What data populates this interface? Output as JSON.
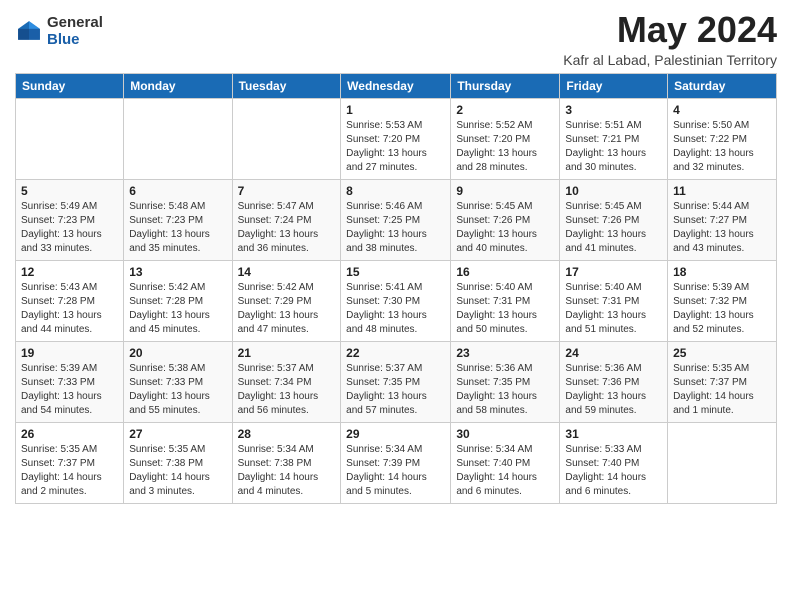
{
  "header": {
    "logo_general": "General",
    "logo_blue": "Blue",
    "month_year": "May 2024",
    "location": "Kafr al Labad, Palestinian Territory"
  },
  "days_of_week": [
    "Sunday",
    "Monday",
    "Tuesday",
    "Wednesday",
    "Thursday",
    "Friday",
    "Saturday"
  ],
  "weeks": [
    [
      {
        "day": "",
        "info": ""
      },
      {
        "day": "",
        "info": ""
      },
      {
        "day": "",
        "info": ""
      },
      {
        "day": "1",
        "info": "Sunrise: 5:53 AM\nSunset: 7:20 PM\nDaylight: 13 hours\nand 27 minutes."
      },
      {
        "day": "2",
        "info": "Sunrise: 5:52 AM\nSunset: 7:20 PM\nDaylight: 13 hours\nand 28 minutes."
      },
      {
        "day": "3",
        "info": "Sunrise: 5:51 AM\nSunset: 7:21 PM\nDaylight: 13 hours\nand 30 minutes."
      },
      {
        "day": "4",
        "info": "Sunrise: 5:50 AM\nSunset: 7:22 PM\nDaylight: 13 hours\nand 32 minutes."
      }
    ],
    [
      {
        "day": "5",
        "info": "Sunrise: 5:49 AM\nSunset: 7:23 PM\nDaylight: 13 hours\nand 33 minutes."
      },
      {
        "day": "6",
        "info": "Sunrise: 5:48 AM\nSunset: 7:23 PM\nDaylight: 13 hours\nand 35 minutes."
      },
      {
        "day": "7",
        "info": "Sunrise: 5:47 AM\nSunset: 7:24 PM\nDaylight: 13 hours\nand 36 minutes."
      },
      {
        "day": "8",
        "info": "Sunrise: 5:46 AM\nSunset: 7:25 PM\nDaylight: 13 hours\nand 38 minutes."
      },
      {
        "day": "9",
        "info": "Sunrise: 5:45 AM\nSunset: 7:26 PM\nDaylight: 13 hours\nand 40 minutes."
      },
      {
        "day": "10",
        "info": "Sunrise: 5:45 AM\nSunset: 7:26 PM\nDaylight: 13 hours\nand 41 minutes."
      },
      {
        "day": "11",
        "info": "Sunrise: 5:44 AM\nSunset: 7:27 PM\nDaylight: 13 hours\nand 43 minutes."
      }
    ],
    [
      {
        "day": "12",
        "info": "Sunrise: 5:43 AM\nSunset: 7:28 PM\nDaylight: 13 hours\nand 44 minutes."
      },
      {
        "day": "13",
        "info": "Sunrise: 5:42 AM\nSunset: 7:28 PM\nDaylight: 13 hours\nand 45 minutes."
      },
      {
        "day": "14",
        "info": "Sunrise: 5:42 AM\nSunset: 7:29 PM\nDaylight: 13 hours\nand 47 minutes."
      },
      {
        "day": "15",
        "info": "Sunrise: 5:41 AM\nSunset: 7:30 PM\nDaylight: 13 hours\nand 48 minutes."
      },
      {
        "day": "16",
        "info": "Sunrise: 5:40 AM\nSunset: 7:31 PM\nDaylight: 13 hours\nand 50 minutes."
      },
      {
        "day": "17",
        "info": "Sunrise: 5:40 AM\nSunset: 7:31 PM\nDaylight: 13 hours\nand 51 minutes."
      },
      {
        "day": "18",
        "info": "Sunrise: 5:39 AM\nSunset: 7:32 PM\nDaylight: 13 hours\nand 52 minutes."
      }
    ],
    [
      {
        "day": "19",
        "info": "Sunrise: 5:39 AM\nSunset: 7:33 PM\nDaylight: 13 hours\nand 54 minutes."
      },
      {
        "day": "20",
        "info": "Sunrise: 5:38 AM\nSunset: 7:33 PM\nDaylight: 13 hours\nand 55 minutes."
      },
      {
        "day": "21",
        "info": "Sunrise: 5:37 AM\nSunset: 7:34 PM\nDaylight: 13 hours\nand 56 minutes."
      },
      {
        "day": "22",
        "info": "Sunrise: 5:37 AM\nSunset: 7:35 PM\nDaylight: 13 hours\nand 57 minutes."
      },
      {
        "day": "23",
        "info": "Sunrise: 5:36 AM\nSunset: 7:35 PM\nDaylight: 13 hours\nand 58 minutes."
      },
      {
        "day": "24",
        "info": "Sunrise: 5:36 AM\nSunset: 7:36 PM\nDaylight: 13 hours\nand 59 minutes."
      },
      {
        "day": "25",
        "info": "Sunrise: 5:35 AM\nSunset: 7:37 PM\nDaylight: 14 hours\nand 1 minute."
      }
    ],
    [
      {
        "day": "26",
        "info": "Sunrise: 5:35 AM\nSunset: 7:37 PM\nDaylight: 14 hours\nand 2 minutes."
      },
      {
        "day": "27",
        "info": "Sunrise: 5:35 AM\nSunset: 7:38 PM\nDaylight: 14 hours\nand 3 minutes."
      },
      {
        "day": "28",
        "info": "Sunrise: 5:34 AM\nSunset: 7:38 PM\nDaylight: 14 hours\nand 4 minutes."
      },
      {
        "day": "29",
        "info": "Sunrise: 5:34 AM\nSunset: 7:39 PM\nDaylight: 14 hours\nand 5 minutes."
      },
      {
        "day": "30",
        "info": "Sunrise: 5:34 AM\nSunset: 7:40 PM\nDaylight: 14 hours\nand 6 minutes."
      },
      {
        "day": "31",
        "info": "Sunrise: 5:33 AM\nSunset: 7:40 PM\nDaylight: 14 hours\nand 6 minutes."
      },
      {
        "day": "",
        "info": ""
      }
    ]
  ]
}
